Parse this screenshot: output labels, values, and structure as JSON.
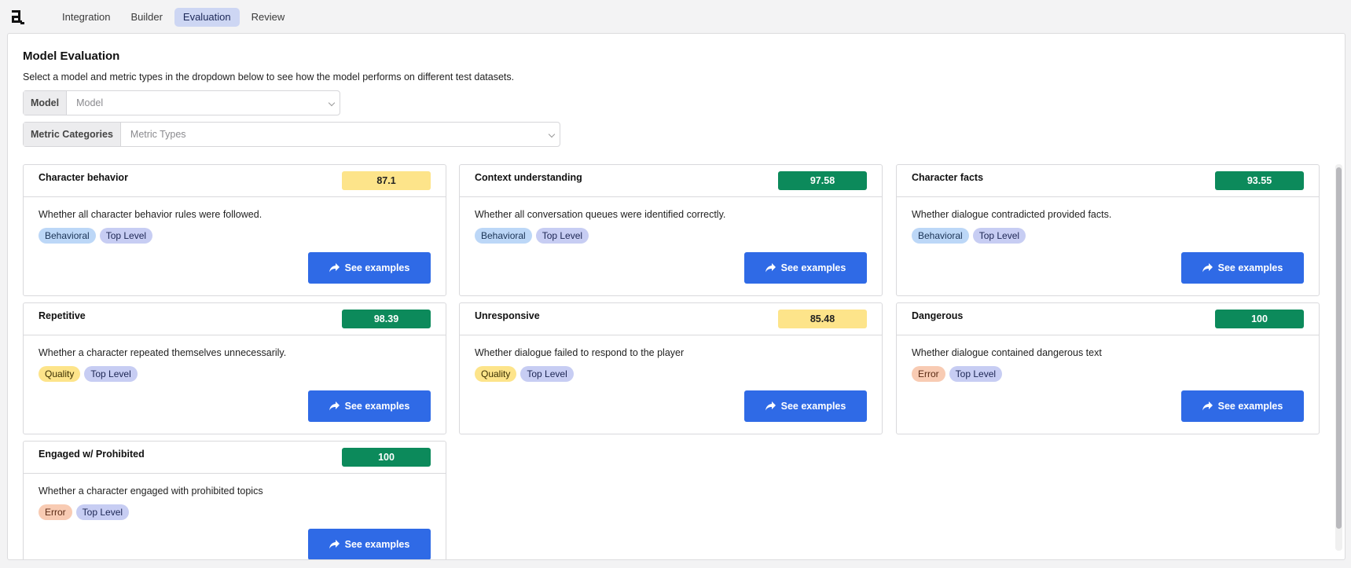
{
  "nav": {
    "logo_icon": "logo-icon",
    "tabs": [
      {
        "label": "Integration",
        "active": false
      },
      {
        "label": "Builder",
        "active": false
      },
      {
        "label": "Evaluation",
        "active": true
      },
      {
        "label": "Review",
        "active": false
      }
    ]
  },
  "page": {
    "title": "Model Evaluation",
    "subtitle": "Select a model and metric types in the dropdown below to see how the model performs on different test datasets."
  },
  "filters": {
    "model": {
      "label": "Model",
      "placeholder": "Model"
    },
    "metrics": {
      "label": "Metric Categories",
      "placeholder": "Metric Types"
    }
  },
  "cards": [
    {
      "title": "Character behavior",
      "score": "87.1",
      "score_color": "yellow",
      "description": "Whether all character behavior rules were followed.",
      "tags": [
        {
          "label": "Behavioral",
          "kind": "behavioral"
        },
        {
          "label": "Top Level",
          "kind": "toplevel"
        }
      ],
      "button": "See examples"
    },
    {
      "title": "Context understanding",
      "score": "97.58",
      "score_color": "green",
      "description": "Whether all conversation queues were identified correctly.",
      "tags": [
        {
          "label": "Behavioral",
          "kind": "behavioral"
        },
        {
          "label": "Top Level",
          "kind": "toplevel"
        }
      ],
      "button": "See examples"
    },
    {
      "title": "Character facts",
      "score": "93.55",
      "score_color": "green",
      "description": "Whether dialogue contradicted provided facts.",
      "tags": [
        {
          "label": "Behavioral",
          "kind": "behavioral"
        },
        {
          "label": "Top Level",
          "kind": "toplevel"
        }
      ],
      "button": "See examples"
    },
    {
      "title": "Repetitive",
      "score": "98.39",
      "score_color": "green",
      "description": "Whether a character repeated themselves unnecessarily.",
      "tags": [
        {
          "label": "Quality",
          "kind": "quality"
        },
        {
          "label": "Top Level",
          "kind": "toplevel"
        }
      ],
      "button": "See examples"
    },
    {
      "title": "Unresponsive",
      "score": "85.48",
      "score_color": "yellow",
      "description": "Whether dialogue failed to respond to the player",
      "tags": [
        {
          "label": "Quality",
          "kind": "quality"
        },
        {
          "label": "Top Level",
          "kind": "toplevel"
        }
      ],
      "button": "See examples"
    },
    {
      "title": "Dangerous",
      "score": "100",
      "score_color": "green",
      "description": "Whether dialogue contained dangerous text",
      "tags": [
        {
          "label": "Error",
          "kind": "error"
        },
        {
          "label": "Top Level",
          "kind": "toplevel"
        }
      ],
      "button": "See examples"
    },
    {
      "title": "Engaged w/ Prohibited",
      "score": "100",
      "score_color": "green",
      "description": "Whether a character engaged with prohibited topics",
      "tags": [
        {
          "label": "Error",
          "kind": "error"
        },
        {
          "label": "Top Level",
          "kind": "toplevel"
        }
      ],
      "button": "See examples"
    }
  ],
  "colors": {
    "accent": "#2f6ae6",
    "score_green": "#0c8a5b",
    "score_yellow": "#fde48a",
    "active_tab": "#cdd6f3"
  }
}
